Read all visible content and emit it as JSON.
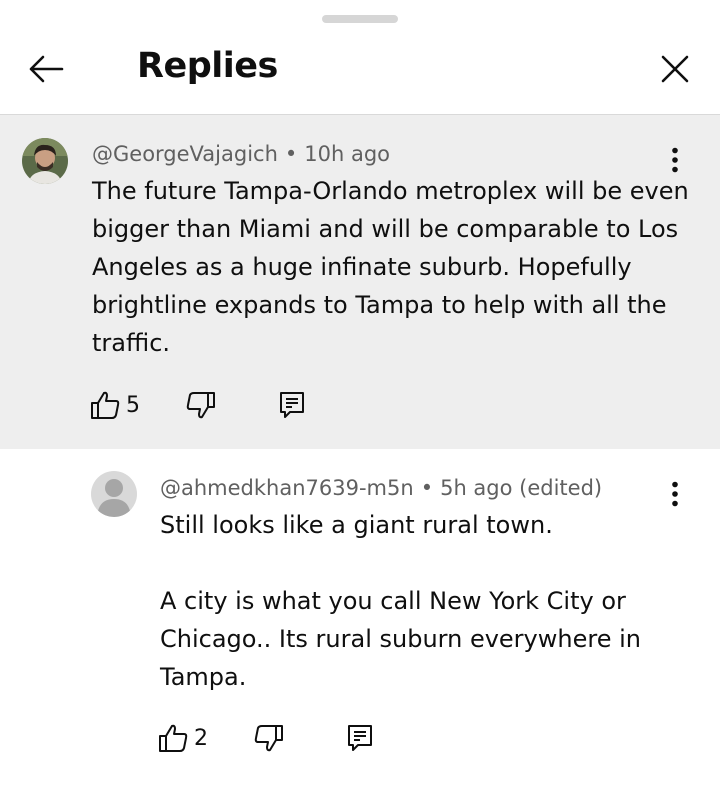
{
  "header": {
    "title": "Replies"
  },
  "comments": [
    {
      "author": "@GeorgeVajagich",
      "separator": "•",
      "time": "10h ago",
      "text": "The future Tampa-Orlando metroplex will be even bigger than Miami and will be comparable to Los Angeles as a huge infinate suburb. Hopefully brightline expands to Tampa to help with all the traffic.",
      "likes": "5"
    },
    {
      "author": "@ahmedkhan7639-m5n",
      "separator": "•",
      "time": "5h ago (edited)",
      "text": "Still looks like a giant rural town.\n\nA city is what you call New York City or Chicago.. Its rural suburn everywhere in Tampa.",
      "likes": "2"
    }
  ],
  "icons": {
    "back": "arrow-left-icon",
    "close": "close-icon",
    "more": "more-vertical-icon",
    "like": "thumbs-up-icon",
    "dislike": "thumbs-down-icon",
    "reply": "comment-icon"
  },
  "colors": {
    "parent_background": "#eeeeee",
    "secondary_text": "#606060",
    "divider": "#d9d9d9"
  }
}
